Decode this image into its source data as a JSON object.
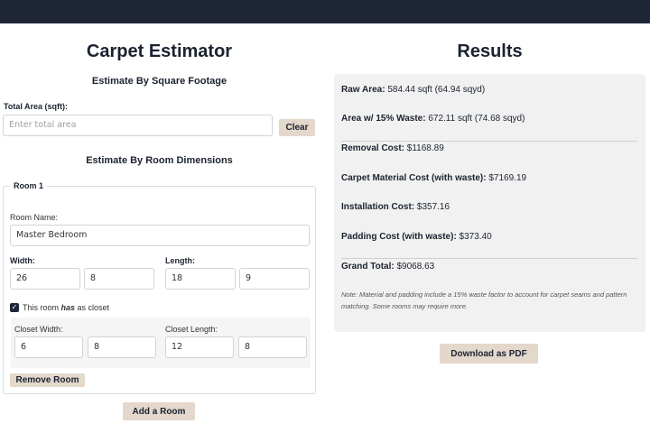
{
  "left": {
    "title": "Carpet Estimator",
    "square_footage": {
      "heading": "Estimate By Square Footage",
      "total_area_label": "Total Area (sqft):",
      "total_area_placeholder": "Enter total area",
      "clear_label": "Clear"
    },
    "room_dimensions": {
      "heading": "Estimate By Room Dimensions",
      "room": {
        "legend": "Room 1",
        "name_label": "Room Name:",
        "name_value": "Master Bedroom",
        "width_label": "Width:",
        "width_ft": "26",
        "width_in": "8",
        "length_label": "Length:",
        "length_ft": "18",
        "length_in": "9",
        "closet_check_pre": "This room ",
        "closet_check_em": "has",
        "closet_check_post": " as closet",
        "closet_width_label": "Closet Width:",
        "closet_width_ft": "6",
        "closet_width_in": "8",
        "closet_length_label": "Closet Length:",
        "closet_length_ft": "12",
        "closet_length_in": "8",
        "remove_label": "Remove Room"
      },
      "add_room_label": "Add a Room"
    }
  },
  "right": {
    "title": "Results",
    "raw_area_key": "Raw Area:",
    "raw_area_val": " 584.44 sqft (64.94 sqyd)",
    "waste_area_key": "Area w/ 15% Waste:",
    "waste_area_val": " 672.11 sqft (74.68 sqyd)",
    "removal_key": "Removal Cost:",
    "removal_val": " $1168.89",
    "material_key": "Carpet Material Cost (with waste):",
    "material_val": " $7169.19",
    "installation_key": "Installation Cost:",
    "installation_val": " $357.16",
    "padding_key": "Padding Cost (with waste):",
    "padding_val": " $373.40",
    "grand_total_key": "Grand Total:",
    "grand_total_val": " $9068.63",
    "note": "Note: Material and padding include a 15% waste factor to account for carpet seams and pattern matching. Some rooms may require more.",
    "download_label": "Download as PDF"
  }
}
